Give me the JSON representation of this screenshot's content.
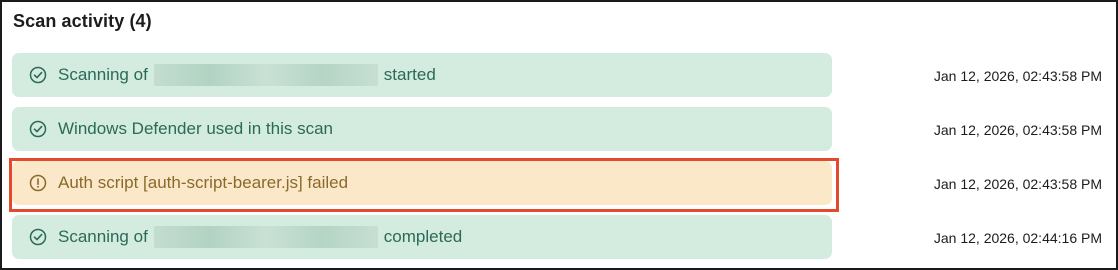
{
  "panel": {
    "title": "Scan activity (4)"
  },
  "events": [
    {
      "status": "success",
      "icon": "check-circle-icon",
      "prefix": "Scanning of",
      "suffix": "started",
      "message": "",
      "timestamp": "Jan 12, 2026, 02:43:58 PM"
    },
    {
      "status": "success",
      "icon": "check-circle-icon",
      "prefix": "",
      "suffix": "",
      "message": "Windows Defender used in this scan",
      "timestamp": "Jan 12, 2026, 02:43:58 PM"
    },
    {
      "status": "warning",
      "icon": "alert-circle-icon",
      "prefix": "",
      "suffix": "",
      "message": "Auth script [auth-script-bearer.js] failed",
      "timestamp": "Jan 12, 2026, 02:43:58 PM"
    },
    {
      "status": "success",
      "icon": "check-circle-icon",
      "prefix": "Scanning of",
      "suffix": "completed",
      "message": "",
      "timestamp": "Jan 12, 2026, 02:44:16 PM"
    }
  ],
  "colors": {
    "success_bg": "#d4ebdf",
    "success_text": "#2b6a57",
    "warning_bg": "#fbe8c9",
    "warning_text": "#8a6a2c",
    "highlight_border": "#e24a2e"
  }
}
